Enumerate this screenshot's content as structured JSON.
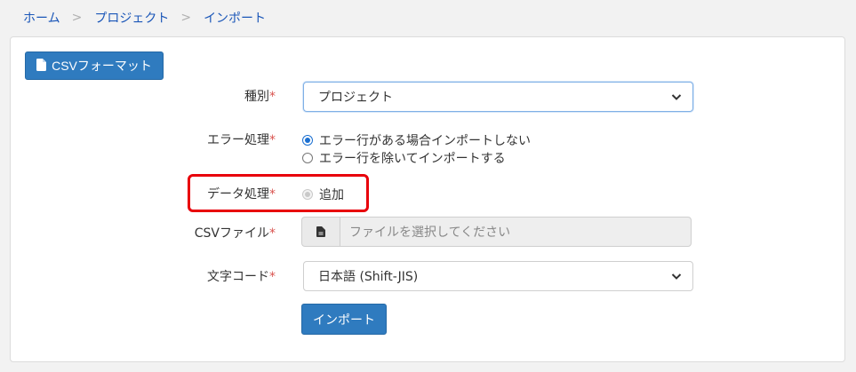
{
  "breadcrumb": {
    "items": [
      "ホーム",
      "プロジェクト",
      "インポート"
    ],
    "separator": ">"
  },
  "toolbar": {
    "csv_format_label": "CSVフォーマット"
  },
  "form": {
    "required_mark": "*",
    "type": {
      "label": "種別",
      "value": "プロジェクト"
    },
    "error_handling": {
      "label": "エラー処理",
      "options": [
        "エラー行がある場合インポートしない",
        "エラー行を除いてインポートする"
      ],
      "selected": 0
    },
    "data_handling": {
      "label": "データ処理",
      "option": "追加",
      "disabled": true
    },
    "csv_file": {
      "label": "CSVファイル",
      "placeholder": "ファイルを選択してください"
    },
    "encoding": {
      "label": "文字コード",
      "value": "日本語 (Shift-JIS)"
    },
    "import_label": "インポート"
  },
  "colors": {
    "accent": "#2f7bbf",
    "link": "#1a56b8",
    "required": "#d9534f",
    "highlight": "#e8000b"
  }
}
